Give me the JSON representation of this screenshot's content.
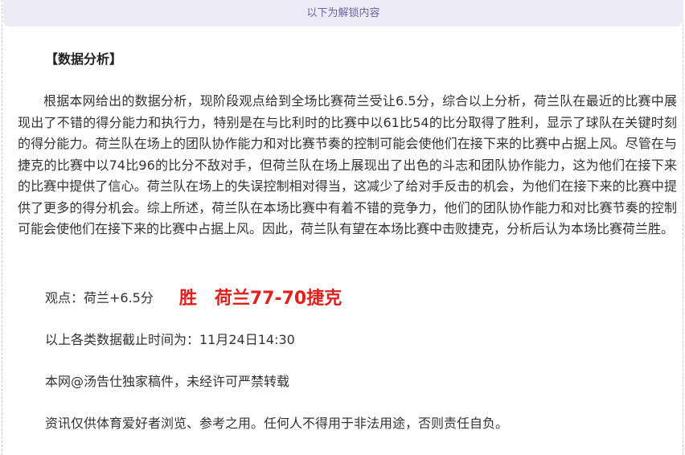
{
  "banner": {
    "text": "以下为解锁内容"
  },
  "article": {
    "heading": "【数据分析】",
    "paragraph": "根据本网给出的数据分析，现阶段观点给到全场比赛荷兰受让6.5分，综合以上分析，荷兰队在最近的比赛中展现出了不错的得分能力和执行力，特别是在与比利时的比赛中以61比54的比分取得了胜利，显示了球队在关键时刻的得分能力。荷兰队在场上的团队协作能力和对比赛节奏的控制可能会使他们在接下来的比赛中占据上风。尽管在与捷克的比赛中以74比96的比分不敌对手，但荷兰队在场上展现出了出色的斗志和团队协作能力，这为他们在接下来的比赛中提供了信心。荷兰队在场上的失误控制相对得当，这减少了给对手反击的机会，为他们在接下来的比赛中提供了更多的得分机会。综上所述，荷兰队在本场比赛中有着不错的竞争力，他们的团队协作能力和对比赛节奏的控制可能会使他们在接下来的比赛中占据上风。因此，荷兰队有望在本场比赛中击败捷克，分析后认为本场比赛荷兰胜。",
    "prediction_label": "观点：荷兰+6.5分",
    "prediction_result": "胜　荷兰77-70捷克",
    "cutoff_time": "以上各类数据截止时间为：11月24日14:30",
    "copyright": "本网@汤告仕独家稿件，未经许可严禁转载",
    "disclaimer": "资讯仅供体育爱好者浏览、参考之用。任何人不得用于非法用途，否则责任自负。"
  },
  "colors": {
    "banner_background": "#ecebf7",
    "banner_text": "#6e64a7",
    "highlight_red": "#e0201e",
    "body_text": "#333333"
  }
}
